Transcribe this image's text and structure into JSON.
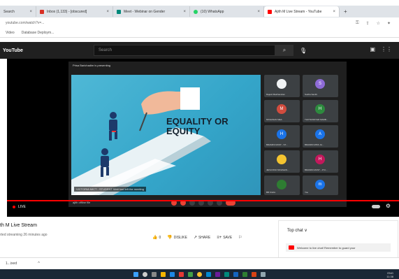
{
  "browser": {
    "tabs": [
      {
        "label": "Search",
        "color": "#4285f4",
        "active": false
      },
      {
        "label": "Inbox (1,133) - [obscured]",
        "color": "#d93025",
        "active": false
      },
      {
        "label": "Meet - Webinar on Gender",
        "color": "#00897b",
        "active": false
      },
      {
        "label": "(10) WhatsApp",
        "color": "#25d366",
        "active": false
      },
      {
        "label": "Ajith M Live Stream - YouTube",
        "color": "#ff0000",
        "active": true
      }
    ],
    "new_tab": "+",
    "url": "youtube.com/watch?v=...",
    "bookmarks": [
      "Video",
      "Database Deploym..."
    ]
  },
  "youtube": {
    "logo": "YouTube",
    "search_placeholder": "Search"
  },
  "meet": {
    "title": "Prisa Barichadim is presenting",
    "slide_title_line1": "EQUALITY OR",
    "slide_title_line2": "EQUITY",
    "caption": "VICTORIA MICT - STUDENT Wait had left the meeting",
    "you_label": "ajith offline file",
    "tiles": [
      {
        "initial": "",
        "name": "Rajesh Balchandran",
        "color": "#f1f3f4"
      },
      {
        "initial": "S",
        "name": "Sudha Santhi",
        "color": "#8e6bd6"
      },
      {
        "initial": "M",
        "name": "MOHANAN MEA",
        "color": "#d14c3e"
      },
      {
        "initial": "H",
        "name": "THOTHWSTHR MARB...",
        "color": "#2d8a3e"
      },
      {
        "initial": "H",
        "name": "BRAMINI MUST - ST...",
        "color": "#1a73e8"
      },
      {
        "initial": "A",
        "name": "BRAMINI MISS JA...",
        "color": "#1a73e8"
      },
      {
        "initial": "",
        "name": "JENUVINO MOHSHIN...",
        "color": "#f4c430"
      },
      {
        "initial": "H",
        "name": "BRAMINI MUST - JTU...",
        "color": "#c2185b"
      },
      {
        "initial": "",
        "name": "BB Krishn",
        "color": "#2e7d32"
      },
      {
        "initial": "m",
        "name": "You",
        "color": "#1a73e8"
      }
    ]
  },
  "player": {
    "live_label": "LIVE"
  },
  "video": {
    "title": "th M Live Stream",
    "meta": "rted streaming 26 minutes ago",
    "like_count": "0",
    "dislike_label": "DISLIKE",
    "share_label": "SHARE",
    "save_label": "SAVE"
  },
  "chat": {
    "title": "Top chat",
    "chevron": "∨",
    "message": "Welcome to live chat! Remember to guard your"
  },
  "download": {
    "item": "1...ixed"
  },
  "taskbar": {
    "lang": "ENG",
    "time": "11:38"
  },
  "colors": {
    "youtube_red": "#ff0000",
    "slide_blue": "#3aaed0",
    "meet_dark": "#1f1f1f"
  }
}
